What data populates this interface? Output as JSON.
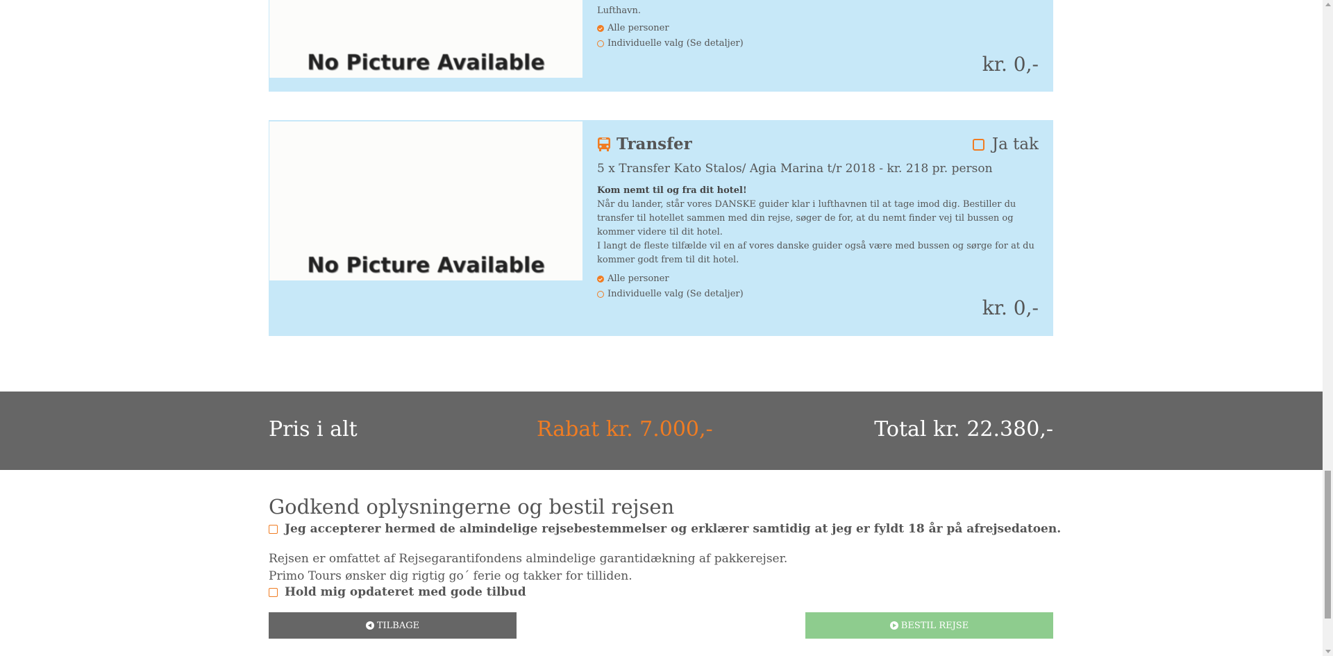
{
  "card1": {
    "desc_partial": "Lufthavn.",
    "image_text": "No Picture Available",
    "option_all": "Alle personer",
    "option_individual": "Individuelle valg (Se detaljer)",
    "price": "kr. 0,-"
  },
  "card2": {
    "title": "Transfer",
    "icon": "bus-icon",
    "ja_tak": "Ja tak",
    "subtitle": "5 x Transfer Kato Stalos/ Agia Marina t/r 2018 - kr. 218 pr. person",
    "desc_heading": "Kom nemt til og fra dit hotel!",
    "desc_p1": "Når du lander, står vores DANSKE guider klar i lufthavnen til at tage imod dig. Bestiller du transfer til hotellet sammen med din rejse, søger de for, at du nemt finder vej til bussen og kommer videre til dit hotel.",
    "desc_p2": "I langt de fleste tilfælde vil en af vores danske guider også være med bussen og sørge for at du kommer godt frem til dit hotel.",
    "image_text": "No Picture Available",
    "option_all": "Alle personer",
    "option_individual": "Individuelle valg (Se detaljer)",
    "price": "kr. 0,-"
  },
  "totals": {
    "label": "Pris i alt",
    "discount": "Rabat kr. 7.000,-",
    "total": "Total kr. 22.380,-"
  },
  "confirm": {
    "heading": "Godkend oplysningerne og bestil rejsen",
    "accept_terms": "Jeg accepterer hermed de almindelige rejsebestemmelser og erklærer samtidig at jeg er fyldt 18 år på afrejsedatoen.",
    "info_line1": "Rejsen er omfattet af Rejsegarantifondens almindelige garantidækning af pakkerejser.",
    "info_line2": "Primo Tours ønsker dig rigtig go´ ferie og takker for tilliden.",
    "newsletter": "Hold mig opdateret med gode tilbud"
  },
  "buttons": {
    "back": "TILBAGE",
    "order": "BESTIL REJSE"
  },
  "colors": {
    "card_bg": "#c7e8f8",
    "accent": "#f07c22",
    "bar_bg": "#666666",
    "order_btn": "#8ecc8e"
  }
}
